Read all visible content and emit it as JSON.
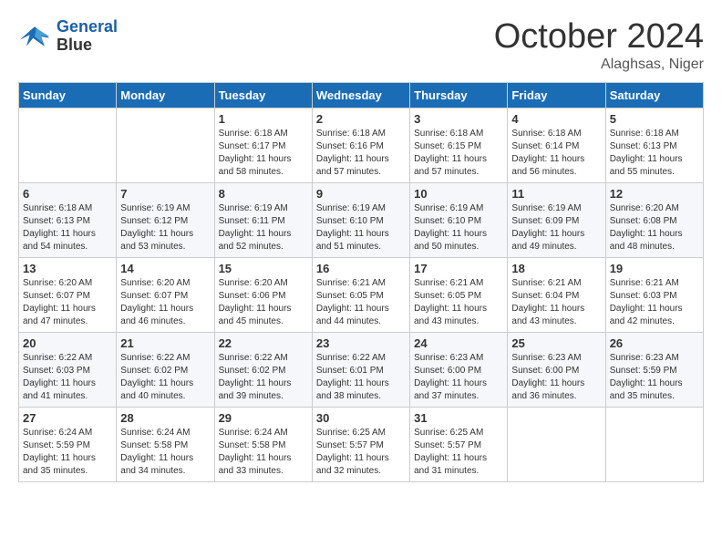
{
  "logo": {
    "line1": "General",
    "line2": "Blue"
  },
  "title": "October 2024",
  "subtitle": "Alaghsas, Niger",
  "days_header": [
    "Sunday",
    "Monday",
    "Tuesday",
    "Wednesday",
    "Thursday",
    "Friday",
    "Saturday"
  ],
  "weeks": [
    [
      {
        "day": "",
        "sunrise": "",
        "sunset": "",
        "daylight": ""
      },
      {
        "day": "",
        "sunrise": "",
        "sunset": "",
        "daylight": ""
      },
      {
        "day": "1",
        "sunrise": "Sunrise: 6:18 AM",
        "sunset": "Sunset: 6:17 PM",
        "daylight": "Daylight: 11 hours and 58 minutes."
      },
      {
        "day": "2",
        "sunrise": "Sunrise: 6:18 AM",
        "sunset": "Sunset: 6:16 PM",
        "daylight": "Daylight: 11 hours and 57 minutes."
      },
      {
        "day": "3",
        "sunrise": "Sunrise: 6:18 AM",
        "sunset": "Sunset: 6:15 PM",
        "daylight": "Daylight: 11 hours and 57 minutes."
      },
      {
        "day": "4",
        "sunrise": "Sunrise: 6:18 AM",
        "sunset": "Sunset: 6:14 PM",
        "daylight": "Daylight: 11 hours and 56 minutes."
      },
      {
        "day": "5",
        "sunrise": "Sunrise: 6:18 AM",
        "sunset": "Sunset: 6:13 PM",
        "daylight": "Daylight: 11 hours and 55 minutes."
      }
    ],
    [
      {
        "day": "6",
        "sunrise": "Sunrise: 6:18 AM",
        "sunset": "Sunset: 6:13 PM",
        "daylight": "Daylight: 11 hours and 54 minutes."
      },
      {
        "day": "7",
        "sunrise": "Sunrise: 6:19 AM",
        "sunset": "Sunset: 6:12 PM",
        "daylight": "Daylight: 11 hours and 53 minutes."
      },
      {
        "day": "8",
        "sunrise": "Sunrise: 6:19 AM",
        "sunset": "Sunset: 6:11 PM",
        "daylight": "Daylight: 11 hours and 52 minutes."
      },
      {
        "day": "9",
        "sunrise": "Sunrise: 6:19 AM",
        "sunset": "Sunset: 6:10 PM",
        "daylight": "Daylight: 11 hours and 51 minutes."
      },
      {
        "day": "10",
        "sunrise": "Sunrise: 6:19 AM",
        "sunset": "Sunset: 6:10 PM",
        "daylight": "Daylight: 11 hours and 50 minutes."
      },
      {
        "day": "11",
        "sunrise": "Sunrise: 6:19 AM",
        "sunset": "Sunset: 6:09 PM",
        "daylight": "Daylight: 11 hours and 49 minutes."
      },
      {
        "day": "12",
        "sunrise": "Sunrise: 6:20 AM",
        "sunset": "Sunset: 6:08 PM",
        "daylight": "Daylight: 11 hours and 48 minutes."
      }
    ],
    [
      {
        "day": "13",
        "sunrise": "Sunrise: 6:20 AM",
        "sunset": "Sunset: 6:07 PM",
        "daylight": "Daylight: 11 hours and 47 minutes."
      },
      {
        "day": "14",
        "sunrise": "Sunrise: 6:20 AM",
        "sunset": "Sunset: 6:07 PM",
        "daylight": "Daylight: 11 hours and 46 minutes."
      },
      {
        "day": "15",
        "sunrise": "Sunrise: 6:20 AM",
        "sunset": "Sunset: 6:06 PM",
        "daylight": "Daylight: 11 hours and 45 minutes."
      },
      {
        "day": "16",
        "sunrise": "Sunrise: 6:21 AM",
        "sunset": "Sunset: 6:05 PM",
        "daylight": "Daylight: 11 hours and 44 minutes."
      },
      {
        "day": "17",
        "sunrise": "Sunrise: 6:21 AM",
        "sunset": "Sunset: 6:05 PM",
        "daylight": "Daylight: 11 hours and 43 minutes."
      },
      {
        "day": "18",
        "sunrise": "Sunrise: 6:21 AM",
        "sunset": "Sunset: 6:04 PM",
        "daylight": "Daylight: 11 hours and 43 minutes."
      },
      {
        "day": "19",
        "sunrise": "Sunrise: 6:21 AM",
        "sunset": "Sunset: 6:03 PM",
        "daylight": "Daylight: 11 hours and 42 minutes."
      }
    ],
    [
      {
        "day": "20",
        "sunrise": "Sunrise: 6:22 AM",
        "sunset": "Sunset: 6:03 PM",
        "daylight": "Daylight: 11 hours and 41 minutes."
      },
      {
        "day": "21",
        "sunrise": "Sunrise: 6:22 AM",
        "sunset": "Sunset: 6:02 PM",
        "daylight": "Daylight: 11 hours and 40 minutes."
      },
      {
        "day": "22",
        "sunrise": "Sunrise: 6:22 AM",
        "sunset": "Sunset: 6:02 PM",
        "daylight": "Daylight: 11 hours and 39 minutes."
      },
      {
        "day": "23",
        "sunrise": "Sunrise: 6:22 AM",
        "sunset": "Sunset: 6:01 PM",
        "daylight": "Daylight: 11 hours and 38 minutes."
      },
      {
        "day": "24",
        "sunrise": "Sunrise: 6:23 AM",
        "sunset": "Sunset: 6:00 PM",
        "daylight": "Daylight: 11 hours and 37 minutes."
      },
      {
        "day": "25",
        "sunrise": "Sunrise: 6:23 AM",
        "sunset": "Sunset: 6:00 PM",
        "daylight": "Daylight: 11 hours and 36 minutes."
      },
      {
        "day": "26",
        "sunrise": "Sunrise: 6:23 AM",
        "sunset": "Sunset: 5:59 PM",
        "daylight": "Daylight: 11 hours and 35 minutes."
      }
    ],
    [
      {
        "day": "27",
        "sunrise": "Sunrise: 6:24 AM",
        "sunset": "Sunset: 5:59 PM",
        "daylight": "Daylight: 11 hours and 35 minutes."
      },
      {
        "day": "28",
        "sunrise": "Sunrise: 6:24 AM",
        "sunset": "Sunset: 5:58 PM",
        "daylight": "Daylight: 11 hours and 34 minutes."
      },
      {
        "day": "29",
        "sunrise": "Sunrise: 6:24 AM",
        "sunset": "Sunset: 5:58 PM",
        "daylight": "Daylight: 11 hours and 33 minutes."
      },
      {
        "day": "30",
        "sunrise": "Sunrise: 6:25 AM",
        "sunset": "Sunset: 5:57 PM",
        "daylight": "Daylight: 11 hours and 32 minutes."
      },
      {
        "day": "31",
        "sunrise": "Sunrise: 6:25 AM",
        "sunset": "Sunset: 5:57 PM",
        "daylight": "Daylight: 11 hours and 31 minutes."
      },
      {
        "day": "",
        "sunrise": "",
        "sunset": "",
        "daylight": ""
      },
      {
        "day": "",
        "sunrise": "",
        "sunset": "",
        "daylight": ""
      }
    ]
  ]
}
